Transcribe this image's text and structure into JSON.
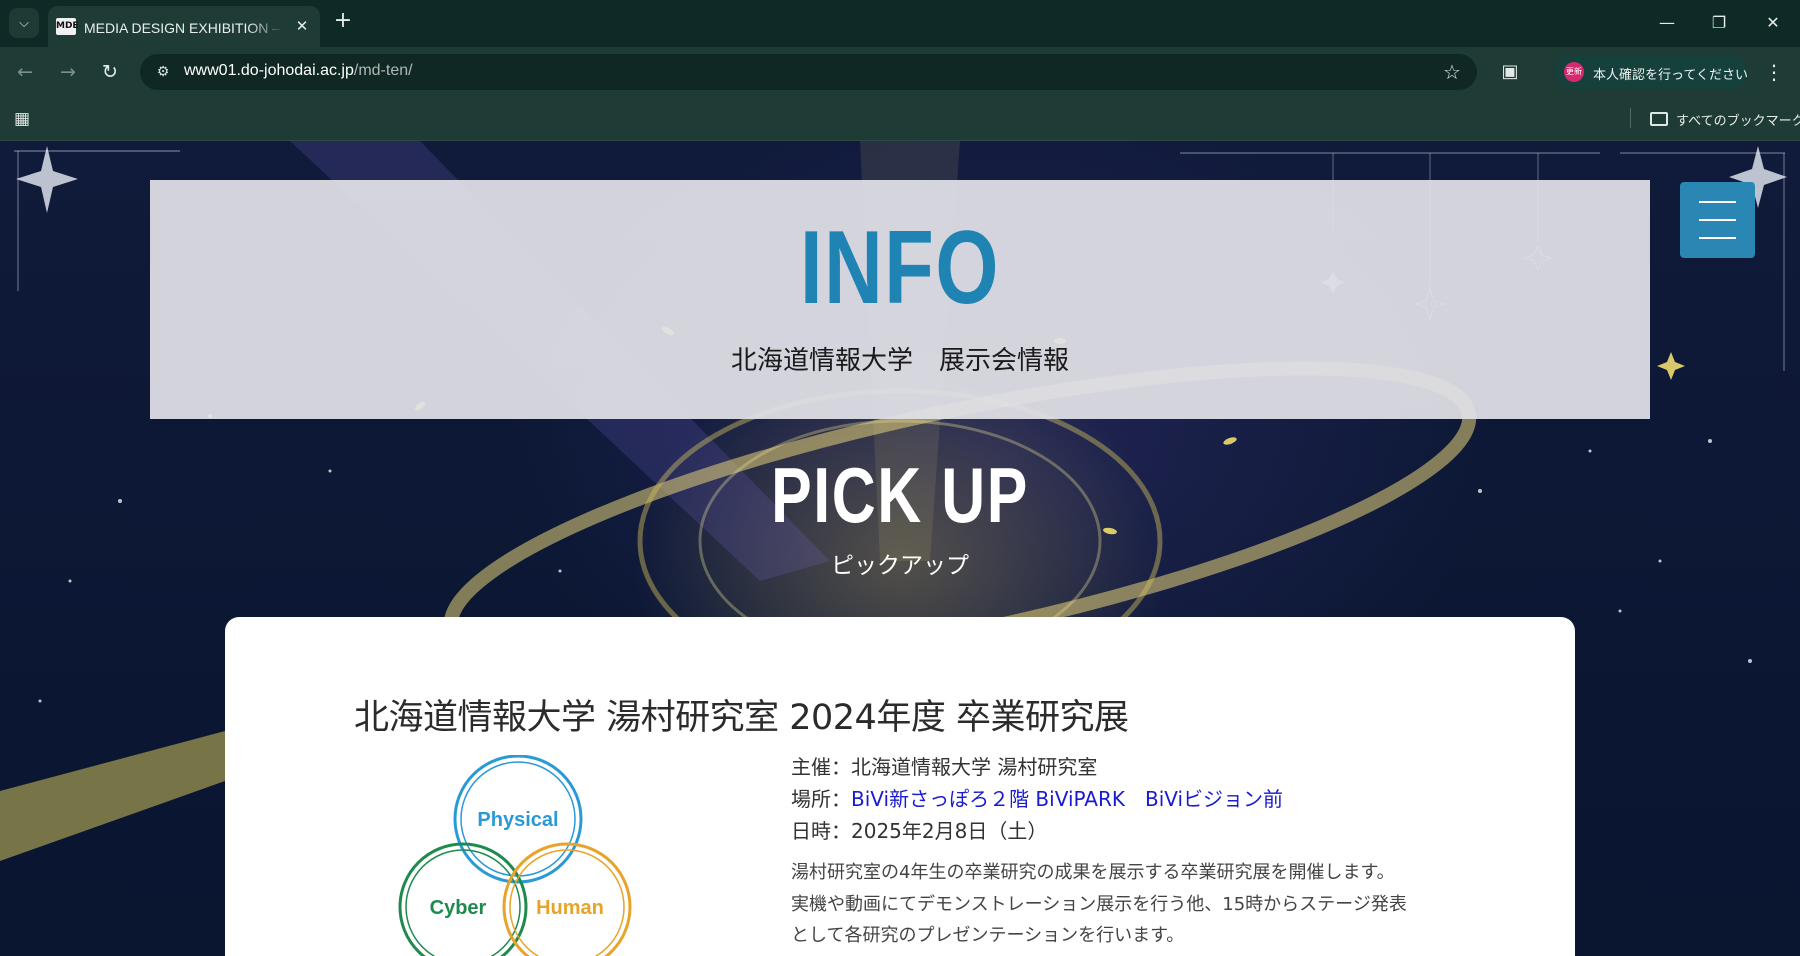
{
  "browser": {
    "tab": {
      "favicon_text": "MDE",
      "title": "MEDIA DESIGN EXHIBITION – 北海道情報大学"
    },
    "url": {
      "host": "www01.do-johodai.ac.jp",
      "path": "/md-ten/"
    },
    "profile": {
      "avatar_text": "更新",
      "label": "本人確認を行ってください"
    },
    "bookmarks": {
      "all_label": "すべてのブックマーク"
    }
  },
  "page": {
    "info": {
      "heading": "INFO",
      "subheading": "北海道情報大学　展示会情報"
    },
    "pickup": {
      "heading": "PICK UP",
      "subheading": "ピックアップ"
    },
    "card": {
      "title": "北海道情報大学 湯村研究室 2024年度 卒業研究展",
      "venn": {
        "circle1": "Physical",
        "circle2": "Cyber",
        "circle3": "Human"
      },
      "details": [
        {
          "label": "主催：",
          "value": "北海道情報大学 湯村研究室",
          "link": false
        },
        {
          "label": "場所：",
          "value": "BiVi新さっぽろ２階 BiViPARK　BiViビジョン前",
          "link": true
        },
        {
          "label": "日時：",
          "value": "2025年2月8日（土）",
          "link": false
        }
      ],
      "description": [
        "湯村研究室の4年生の卒業研究の成果を展示する卒業研究展を開催します。",
        "実機や動画にてデモンストレーション展示を行う他、15時からステージ発表",
        "として各研究のプレゼンテーションを行います。"
      ]
    }
  },
  "colors": {
    "accent_blue": "#1f84b3",
    "venn_physical": "#2a9ad6",
    "venn_cyber": "#1f8a4e",
    "venn_human": "#e8a32a",
    "link": "#1a1ad0"
  }
}
